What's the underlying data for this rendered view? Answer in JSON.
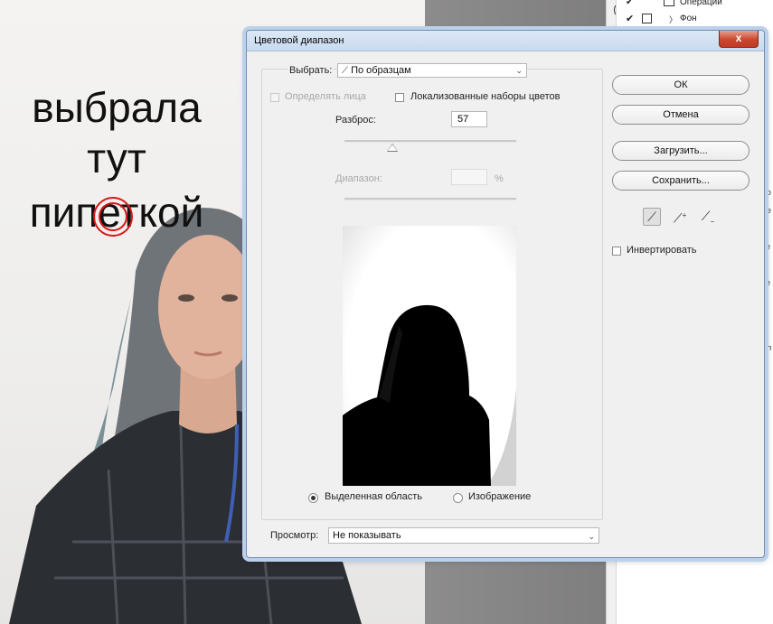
{
  "annotation": {
    "lines": [
      "выбрала",
      "тут",
      "пипеткой"
    ],
    "color": "#d81818"
  },
  "layers_panel": {
    "row1_label": "Операции",
    "row2_label": "Фон"
  },
  "dialog": {
    "title": "Цветовой диапазон",
    "close_glyph": "x",
    "select_label": "Выбрать:",
    "select_value": "По образцам",
    "detect_faces_label": "Определять лица",
    "localized_label": "Локализованные наборы цветов",
    "fuzziness_label": "Разброс:",
    "fuzziness_value": "57",
    "range_label": "Диапазон:",
    "range_unit": "%",
    "radio_selection_label": "Выделенная область",
    "radio_image_label": "Изображение",
    "preview_label": "Просмотр:",
    "preview_value": "Не показывать",
    "buttons": {
      "ok": "ОК",
      "cancel": "Отмена",
      "load": "Загрузить...",
      "save": "Сохранить..."
    },
    "invert_label": "Инвертировать",
    "icons": [
      "eyedropper-icon",
      "eyedropper-plus-icon",
      "eyedropper-minus-icon"
    ]
  }
}
